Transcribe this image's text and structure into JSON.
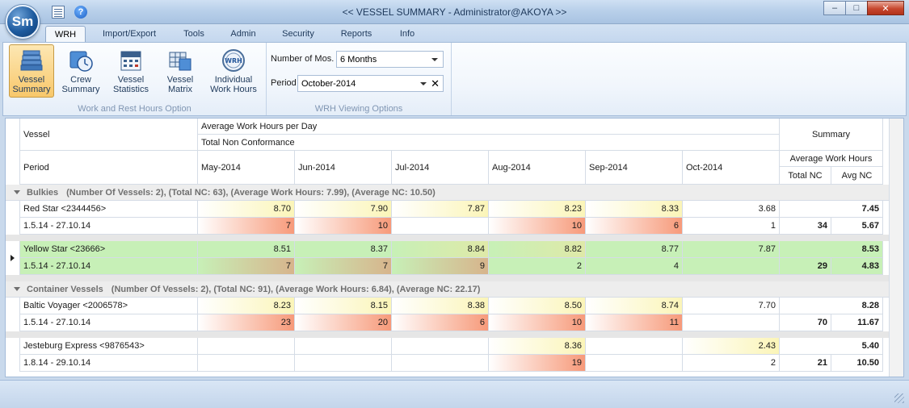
{
  "window": {
    "app_logo": "Sm",
    "title": "<< VESSEL SUMMARY - Administrator@AKOYA >>",
    "controls": [
      "minimize",
      "maximize",
      "close"
    ]
  },
  "quick_access": [
    {
      "icon": "list-icon"
    },
    {
      "icon": "help-icon",
      "label": "?"
    }
  ],
  "tabs": [
    "WRH",
    "Import/Export",
    "Tools",
    "Admin",
    "Security",
    "Reports",
    "Info"
  ],
  "active_tab": "WRH",
  "ribbon": {
    "work_rest_group": {
      "caption": "Work and Rest Hours Option",
      "buttons": [
        {
          "line1": "Vessel",
          "line2": "Summary",
          "active": true
        },
        {
          "line1": "Crew",
          "line2": "Summary"
        },
        {
          "line1": "Vessel",
          "line2": "Statistics"
        },
        {
          "line1": "Vessel",
          "line2": "Matrix"
        },
        {
          "line1": "Individual",
          "line2": "Work Hours"
        }
      ]
    },
    "viewing_group": {
      "caption": "WRH Viewing Options",
      "months_label": "Number of Mos.",
      "months_value": "6 Months",
      "period_label": "Period",
      "period_value": "October-2014"
    }
  },
  "grid": {
    "header": {
      "vessel": "Vessel",
      "period": "Period",
      "avg_work_hours_per_day": "Average Work Hours per Day",
      "total_non_conformance": "Total Non Conformance",
      "months": [
        "May-2014",
        "Jun-2014",
        "Jul-2014",
        "Aug-2014",
        "Sep-2014",
        "Oct-2014"
      ],
      "summary": "Summary",
      "summary_avg": "Average Work Hours",
      "total_nc": "Total NC",
      "avg_nc": "Avg NC"
    },
    "groups": [
      {
        "caption": "Bulkies",
        "stats": "(Number Of Vessels: 2), (Total NC: 63), (Average Work Hours: 7.99), (Average NC: 10.50)",
        "vessels": [
          {
            "name": "Red Star <2344456>",
            "period": "1.5.14 - 27.10.14",
            "hours": [
              "8.70",
              "7.90",
              "7.87",
              "8.23",
              "8.33",
              "3.68"
            ],
            "nc": [
              "7",
              "10",
              "",
              "10",
              "6",
              "1"
            ],
            "avg_hours": "7.45",
            "total_nc": "34",
            "avg_nc": "5.67"
          },
          {
            "name": "Yellow Star <23666>",
            "period": "1.5.14 - 27.10.14",
            "hours": [
              "8.51",
              "8.37",
              "8.84",
              "8.82",
              "8.77",
              "7.87"
            ],
            "nc": [
              "7",
              "7",
              "9",
              "2",
              "4",
              ""
            ],
            "avg_hours": "8.53",
            "total_nc": "29",
            "avg_nc": "4.83",
            "selected": true
          }
        ]
      },
      {
        "caption": "Container Vessels",
        "stats": "(Number Of Vessels: 2), (Total NC: 91), (Average Work Hours: 6.84), (Average NC: 22.17)",
        "vessels": [
          {
            "name": "Baltic Voyager <2006578>",
            "period": "1.5.14 - 27.10.14",
            "hours": [
              "8.23",
              "8.15",
              "8.38",
              "8.50",
              "8.74",
              "7.70"
            ],
            "nc": [
              "23",
              "20",
              "6",
              "10",
              "11",
              ""
            ],
            "avg_hours": "8.28",
            "total_nc": "70",
            "avg_nc": "11.67"
          },
          {
            "name": "Jesteburg Express <9876543>",
            "period": "1.8.14 - 29.10.14",
            "hours": [
              "",
              "",
              "",
              "8.36",
              "",
              "2.43"
            ],
            "nc": [
              "",
              "",
              "",
              "19",
              "",
              "2"
            ],
            "avg_hours": "5.40",
            "total_nc": "21",
            "avg_nc": "10.50"
          }
        ]
      }
    ]
  },
  "colors": {
    "hours_highlight": "#fbf5b8",
    "nc_highlight": "#f79a7a",
    "selected_row": "#c7f0b7"
  }
}
